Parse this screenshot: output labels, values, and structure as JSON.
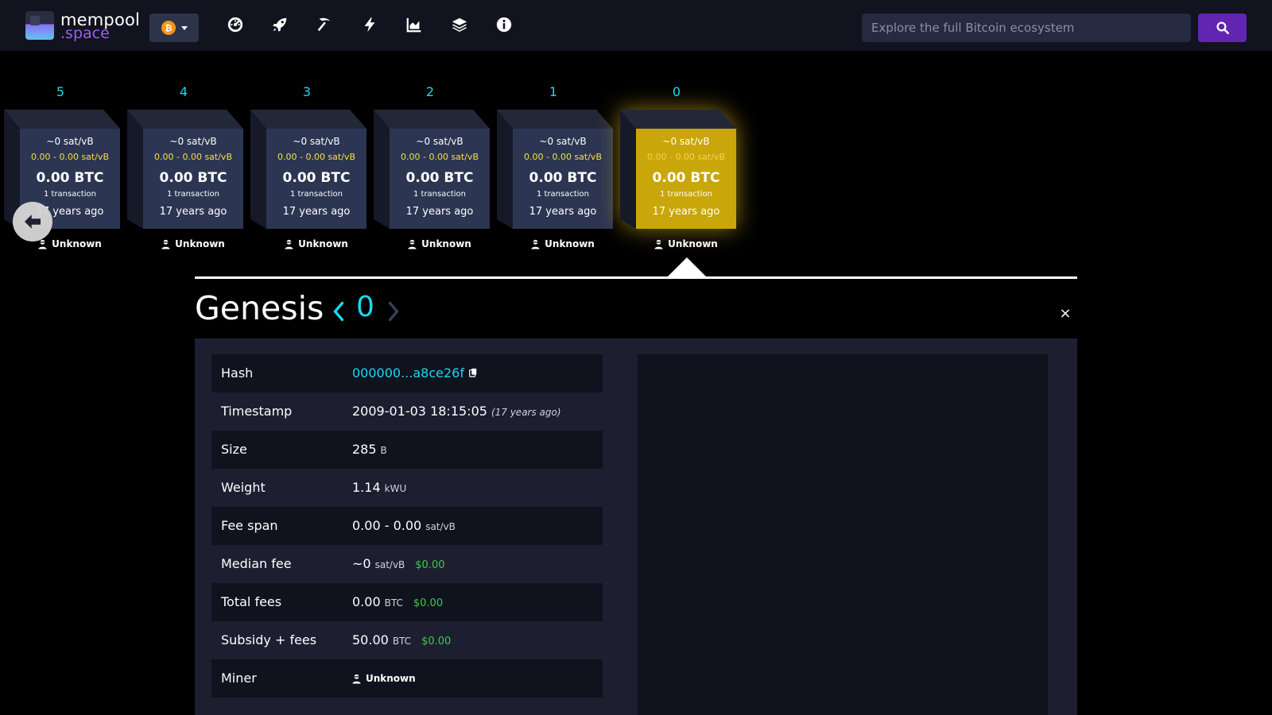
{
  "header": {
    "logo_line1": "mempool",
    "logo_line2": ".space",
    "network_symbol": "₿",
    "search": {
      "placeholder": "Explore the full Bitcoin ecosystem"
    },
    "nav_icons": [
      "dashboard-icon",
      "rocket-icon",
      "pickaxe-icon",
      "lightning-icon",
      "chart-icon",
      "layers-icon",
      "info-icon"
    ],
    "colors": {
      "navbar_bg": "#11131f",
      "search_button": "#6225b2",
      "accent_cyan": "#1bd8f4"
    }
  },
  "blocks": [
    {
      "height": "5",
      "fee_median": "~0 sat/vB",
      "fee_range": "0.00 - 0.00 sat/vB",
      "size": "0.00 BTC",
      "tx_count": "1 transaction",
      "time": "17 years ago",
      "miner": "Unknown",
      "selected": false
    },
    {
      "height": "4",
      "fee_median": "~0 sat/vB",
      "fee_range": "0.00 - 0.00 sat/vB",
      "size": "0.00 BTC",
      "tx_count": "1 transaction",
      "time": "17 years ago",
      "miner": "Unknown",
      "selected": false
    },
    {
      "height": "3",
      "fee_median": "~0 sat/vB",
      "fee_range": "0.00 - 0.00 sat/vB",
      "size": "0.00 BTC",
      "tx_count": "1 transaction",
      "time": "17 years ago",
      "miner": "Unknown",
      "selected": false
    },
    {
      "height": "2",
      "fee_median": "~0 sat/vB",
      "fee_range": "0.00 - 0.00 sat/vB",
      "size": "0.00 BTC",
      "tx_count": "1 transaction",
      "time": "17 years ago",
      "miner": "Unknown",
      "selected": false
    },
    {
      "height": "1",
      "fee_median": "~0 sat/vB",
      "fee_range": "0.00 - 0.00 sat/vB",
      "size": "0.00 BTC",
      "tx_count": "1 transaction",
      "time": "17 years ago",
      "miner": "Unknown",
      "selected": false
    },
    {
      "height": "0",
      "fee_median": "~0 sat/vB",
      "fee_range": "0.00 - 0.00 sat/vB",
      "size": "0.00 BTC",
      "tx_count": "1 transaction",
      "time": "17 years ago",
      "miner": "Unknown",
      "selected": true
    }
  ],
  "block_colors": {
    "default_face": "#2c3552",
    "selected_face": "#c9a60a",
    "fee_range_text": "#f2e042"
  },
  "title": {
    "name": "Genesis",
    "height": "0",
    "close_symbol": "×"
  },
  "details": {
    "hash": {
      "label": "Hash",
      "value": "000000...a8ce26f"
    },
    "timestamp": {
      "label": "Timestamp",
      "value": "2009-01-03 18:15:05",
      "ago": "(17 years ago)"
    },
    "size": {
      "label": "Size",
      "value": "285",
      "unit": "B"
    },
    "weight": {
      "label": "Weight",
      "value": "1.14",
      "unit": "kWU"
    },
    "fee_span": {
      "label": "Fee span",
      "value": "0.00 - 0.00",
      "unit": "sat/vB"
    },
    "median_fee": {
      "label": "Median fee",
      "value": "~0",
      "unit": "sat/vB",
      "usd": "$0.00"
    },
    "total_fees": {
      "label": "Total fees",
      "value": "0.00",
      "unit": "BTC",
      "usd": "$0.00"
    },
    "subsidy_fees": {
      "label": "Subsidy + fees",
      "value": "50.00",
      "unit": "BTC",
      "usd": "$0.00"
    },
    "miner": {
      "label": "Miner",
      "value": "Unknown"
    }
  },
  "detail_colors": {
    "panel_bg": "#1d1f31",
    "row_stripe": "#10121d",
    "usd_green": "#3bcc49"
  }
}
